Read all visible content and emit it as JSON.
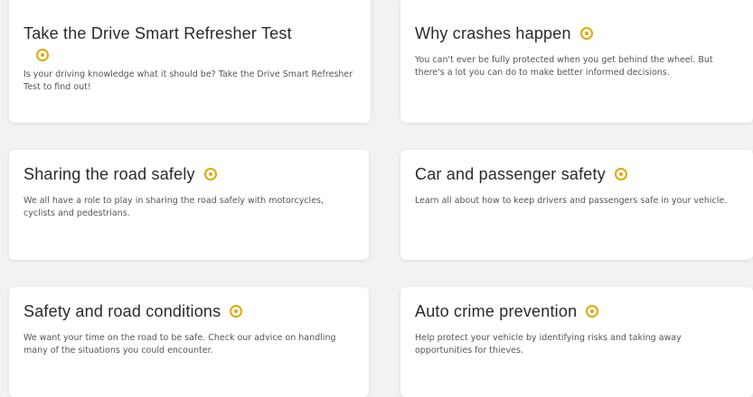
{
  "cards": [
    {
      "title": "Take the Drive Smart Refresher Test",
      "description": "Is your driving knowledge what it should be? Take the Drive Smart Refresher Test to find out!",
      "icon": "info-circle-icon"
    },
    {
      "title": "Why crashes happen",
      "description": "You can't ever be fully protected when you get behind the wheel. But there's a lot you can do to make better informed decisions.",
      "icon": "info-circle-icon"
    },
    {
      "title": "Sharing the road safely",
      "description": "We all have a role to play in sharing the road safely with motorcycles, cyclists and pedestrians.",
      "icon": "info-circle-icon"
    },
    {
      "title": "Car and passenger safety",
      "description": "Learn all about how to keep drivers and passengers safe in your vehicle.",
      "icon": "info-circle-icon"
    },
    {
      "title": "Safety and road conditions",
      "description": "We want your time on the road to be safe. Check our advice on handling many of the situations you could encounter.",
      "icon": "info-circle-icon"
    },
    {
      "title": "Auto crime prevention",
      "description": "Help protect your vehicle by identifying risks and taking away opportunities for thieves.",
      "icon": "info-circle-icon"
    }
  ],
  "colors": {
    "accent": "#e0a800",
    "card_background": "#ffffff",
    "page_background": "#f2f2f2",
    "title_text": "#2a2a2a",
    "body_text": "#555555"
  }
}
